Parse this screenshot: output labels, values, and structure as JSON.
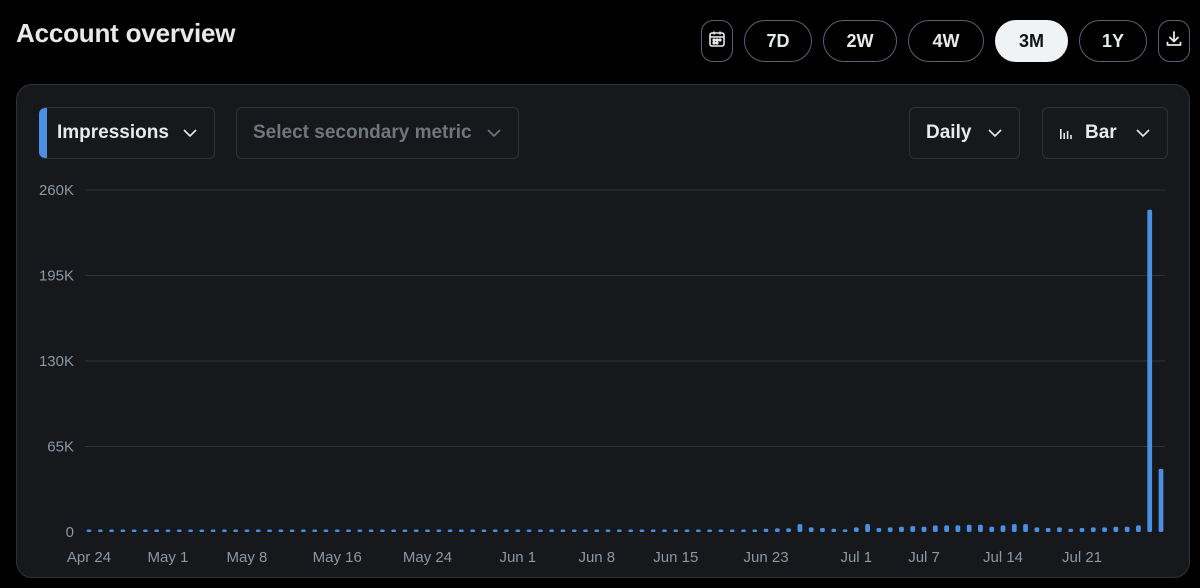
{
  "header": {
    "title": "Account overview"
  },
  "range": {
    "calendar_icon": "calendar-icon",
    "options": [
      "7D",
      "2W",
      "4W",
      "3M",
      "1Y"
    ],
    "selected": "3M",
    "download_icon": "download-icon"
  },
  "controls": {
    "primary_metric": "Impressions",
    "secondary_metric_placeholder": "Select secondary metric",
    "interval": "Daily",
    "chart_type": "Bar"
  },
  "colors": {
    "accent": "#4a90e2",
    "background": "#000000",
    "panel": "#16181c",
    "grid": "#2f3336",
    "tick": "#8b98a5"
  },
  "chart_data": {
    "type": "bar",
    "title": "",
    "xlabel": "",
    "ylabel": "",
    "ylim": [
      0,
      260000
    ],
    "yticks": [
      "260K",
      "195K",
      "130K",
      "65K",
      "0"
    ],
    "ytick_values": [
      260000,
      195000,
      130000,
      65000,
      0
    ],
    "xtick_labels": [
      "Apr 24",
      "May 1",
      "May 8",
      "May 16",
      "May 24",
      "Jun 1",
      "Jun 8",
      "Jun 15",
      "Jun 23",
      "Jul 1",
      "Jul 7",
      "Jul 14",
      "Jul 21"
    ],
    "xtick_dates": [
      "2024-04-24",
      "2024-05-01",
      "2024-05-08",
      "2024-05-16",
      "2024-05-24",
      "2024-06-01",
      "2024-06-08",
      "2024-06-15",
      "2024-06-23",
      "2024-07-01",
      "2024-07-07",
      "2024-07-14",
      "2024-07-21"
    ],
    "start_date": "2024-04-24",
    "series": [
      {
        "name": "Impressions",
        "values": [
          300,
          300,
          300,
          300,
          300,
          500,
          1500,
          800,
          500,
          300,
          300,
          300,
          500,
          1500,
          800,
          500,
          300,
          300,
          300,
          300,
          300,
          300,
          300,
          300,
          300,
          300,
          300,
          300,
          300,
          300,
          300,
          300,
          300,
          300,
          300,
          500,
          500,
          500,
          500,
          500,
          500,
          500,
          700,
          800,
          1800,
          1800,
          1500,
          1200,
          800,
          800,
          800,
          1500,
          1000,
          800,
          800,
          800,
          1000,
          1500,
          1500,
          1800,
          2500,
          2800,
          2800,
          6000,
          3500,
          3000,
          2500,
          2000,
          3500,
          6000,
          3000,
          3500,
          4000,
          4500,
          4000,
          5000,
          5000,
          5000,
          5500,
          5500,
          4000,
          5000,
          6000,
          6000,
          3500,
          3000,
          3500,
          2500,
          3000,
          3500,
          3500,
          4000,
          4000,
          5000,
          245000,
          48000
        ]
      }
    ],
    "grid": true,
    "legend": "none"
  }
}
